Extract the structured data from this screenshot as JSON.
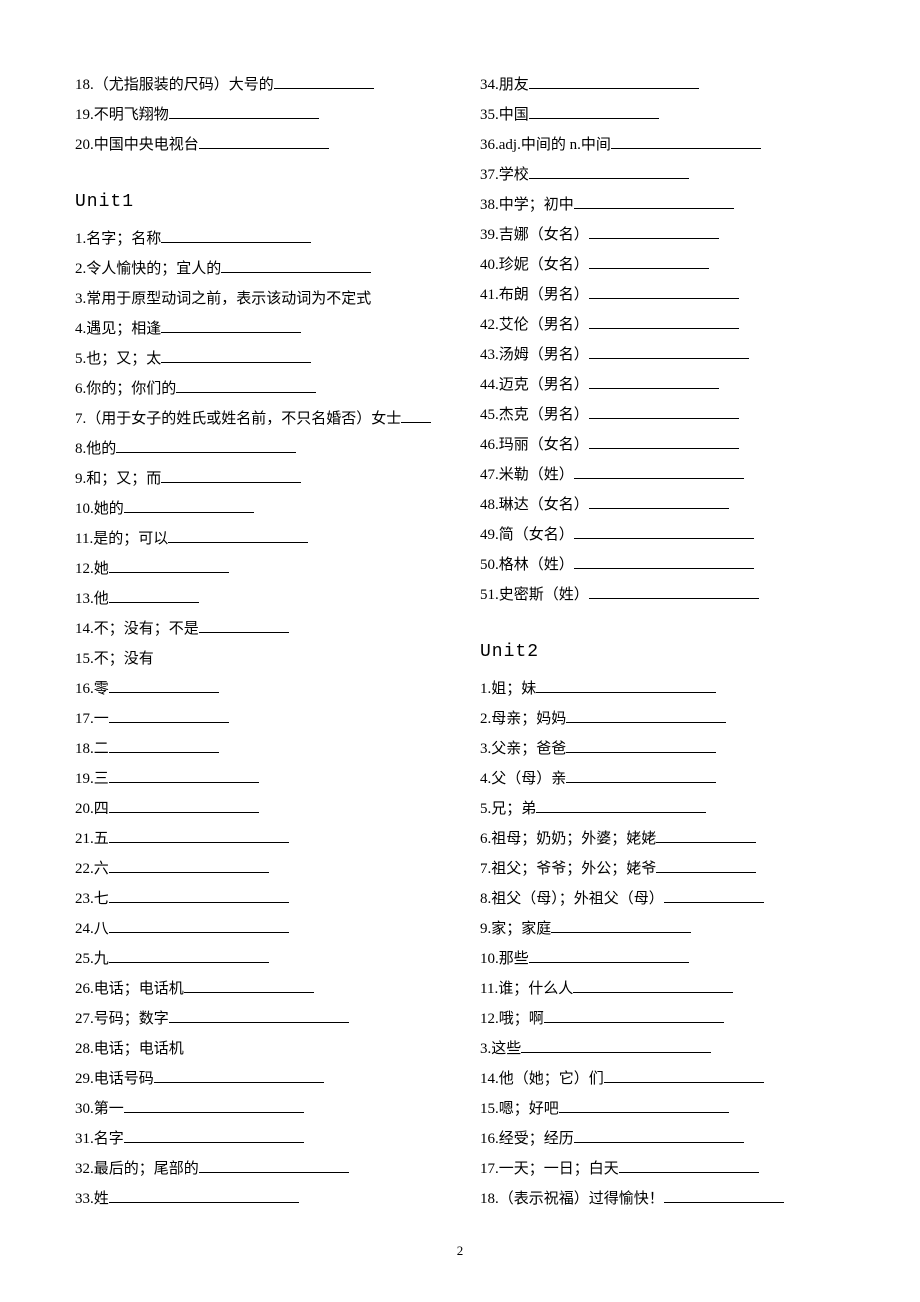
{
  "pageNumber": "2",
  "left": {
    "pre": [
      {
        "n": "18.",
        "t": "（尤指服装的尺码）大号的",
        "w": 100
      },
      {
        "n": "19.",
        "t": "不明飞翔物",
        "w": 150
      },
      {
        "n": "20.",
        "t": "中国中央电视台",
        "w": 130
      }
    ],
    "unit": "Unit1",
    "items": [
      {
        "n": "1.",
        "t": "名字；名称",
        "w": 150
      },
      {
        "n": "2.",
        "t": "令人愉快的；宜人的",
        "w": 150
      },
      {
        "n": "3.",
        "t": "常用于原型动词之前，表示该动词为不定式",
        "w": 0
      },
      {
        "n": "4.",
        "t": "遇见；相逢",
        "w": 140
      },
      {
        "n": "5.",
        "t": "也；又；太",
        "w": 150
      },
      {
        "n": "6.",
        "t": "你的；你们的",
        "w": 140
      },
      {
        "n": "7.",
        "t": "（用于女子的姓氏或姓名前，不只名婚否）女士",
        "w": 30
      },
      {
        "n": "8.",
        "t": "他的",
        "w": 180
      },
      {
        "n": "9.",
        "t": "和；又；而",
        "w": 140
      },
      {
        "n": "10.",
        "t": "她的",
        "w": 130
      },
      {
        "n": "11.",
        "t": "是的；可以",
        "w": 140
      },
      {
        "n": "12.",
        "t": "她",
        "w": 120
      },
      {
        "n": "13.",
        "t": "他",
        "w": 90
      },
      {
        "n": "14.",
        "t": "不；没有；不是",
        "w": 90
      },
      {
        "n": "15.",
        "t": "不；没有",
        "w": 0
      },
      {
        "n": "16.",
        "t": "零",
        "w": 110
      },
      {
        "n": "17.",
        "t": "一",
        "w": 120
      },
      {
        "n": "18.",
        "t": "二",
        "w": 110
      },
      {
        "n": "19.",
        "t": "三",
        "w": 150
      },
      {
        "n": "20.",
        "t": "四",
        "w": 150
      },
      {
        "n": "21.",
        "t": "五",
        "w": 180
      },
      {
        "n": "22.",
        "t": "六",
        "w": 160
      },
      {
        "n": "23.",
        "t": "七",
        "w": 180
      },
      {
        "n": "24.",
        "t": "八",
        "w": 180
      },
      {
        "n": "25.",
        "t": "九",
        "w": 160
      },
      {
        "n": "26.",
        "t": "电话；电话机",
        "w": 130
      },
      {
        "n": "27.",
        "t": "号码；数字",
        "w": 180
      },
      {
        "n": "28.",
        "t": "电话；电话机",
        "w": 0
      },
      {
        "n": "29.",
        "t": "电话号码",
        "w": 170
      },
      {
        "n": "30.",
        "t": "第一",
        "w": 180
      },
      {
        "n": "31.",
        "t": "名字",
        "w": 180
      },
      {
        "n": "32.",
        "t": "最后的；尾部的",
        "w": 150
      },
      {
        "n": "33.",
        "t": "姓",
        "w": 190
      }
    ]
  },
  "right": {
    "cont": [
      {
        "n": "34.",
        "t": "朋友",
        "w": 170
      },
      {
        "n": "35.",
        "t": "中国",
        "w": 130
      },
      {
        "n": "36.",
        "t": "adj.中间的 n.中间",
        "w": 150
      },
      {
        "n": "37.",
        "t": "学校",
        "w": 160
      },
      {
        "n": "38.",
        "t": "中学；初中",
        "w": 160
      },
      {
        "n": "39.",
        "t": "吉娜（女名）",
        "w": 130
      },
      {
        "n": "40.",
        "t": "珍妮（女名）",
        "w": 120
      },
      {
        "n": "41.",
        "t": "布朗（男名）",
        "w": 150
      },
      {
        "n": "42.",
        "t": "艾伦（男名）",
        "w": 150
      },
      {
        "n": "43.",
        "t": "汤姆（男名）",
        "w": 160
      },
      {
        "n": "44.",
        "t": "迈克（男名）",
        "w": 130
      },
      {
        "n": "45.",
        "t": "杰克（男名）",
        "w": 150
      },
      {
        "n": "46.",
        "t": "玛丽（女名）",
        "w": 150
      },
      {
        "n": "47.",
        "t": "米勒（姓）",
        "w": 170
      },
      {
        "n": "48.",
        "t": "琳达（女名）",
        "w": 140
      },
      {
        "n": "49.",
        "t": "简（女名）",
        "w": 180
      },
      {
        "n": "50.",
        "t": "格林（姓）",
        "w": 180
      },
      {
        "n": "51.",
        "t": "史密斯（姓）",
        "w": 170
      }
    ],
    "unit": "Unit2",
    "items": [
      {
        "n": "1.",
        "t": "姐；妹",
        "w": 180
      },
      {
        "n": "2.",
        "t": "母亲；妈妈",
        "w": 160
      },
      {
        "n": "3.",
        "t": "父亲；爸爸",
        "w": 150
      },
      {
        "n": "4.",
        "t": "父（母）亲",
        "w": 150
      },
      {
        "n": "5.",
        "t": "兄；弟",
        "w": 170
      },
      {
        "n": "6.",
        "t": "祖母；奶奶；外婆；姥姥",
        "w": 100
      },
      {
        "n": "7.",
        "t": "祖父；爷爷；外公；姥爷",
        "w": 100
      },
      {
        "n": "8.",
        "t": "祖父（母）；外祖父（母）",
        "w": 100
      },
      {
        "n": "9.",
        "t": "家；家庭",
        "w": 140
      },
      {
        "n": "10.",
        "t": "那些",
        "w": 160
      },
      {
        "n": "11.",
        "t": "谁；什么人",
        "w": 160
      },
      {
        "n": "12.",
        "t": "哦；啊",
        "w": 180
      },
      {
        "n": "3.",
        "t": "这些",
        "w": 190
      },
      {
        "n": "14.",
        "t": "他（她；它）们",
        "w": 160
      },
      {
        "n": "15.",
        "t": "嗯；好吧",
        "w": 170
      },
      {
        "n": "16.",
        "t": "经受；经历",
        "w": 170
      },
      {
        "n": "17.",
        "t": "一天；一日；白天",
        "w": 140
      },
      {
        "n": "18.",
        "t": "（表示祝福）过得愉快！",
        "w": 120
      }
    ]
  }
}
